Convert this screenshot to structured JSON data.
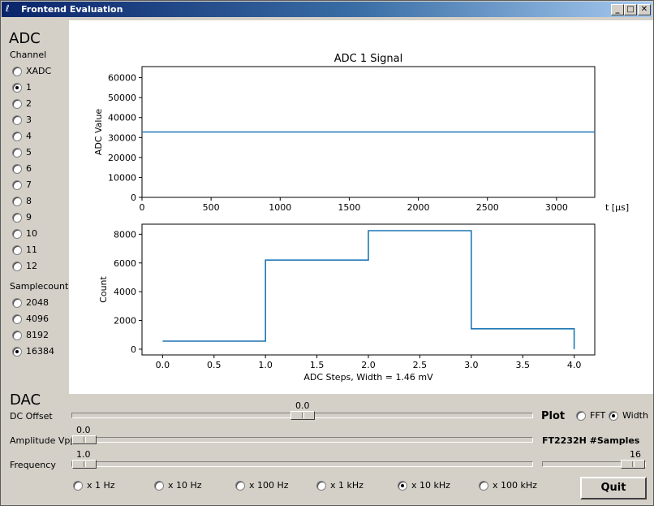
{
  "window": {
    "title": "Frontend Evaluation",
    "minimize": "_",
    "maximize": "□",
    "close": "✕"
  },
  "adc": {
    "heading": "ADC",
    "channel_label": "Channel",
    "channels": [
      "XADC",
      "1",
      "2",
      "3",
      "4",
      "5",
      "6",
      "7",
      "8",
      "9",
      "10",
      "11",
      "12"
    ],
    "channel_selected": "1",
    "samplecount_label": "Samplecount",
    "samplecounts": [
      "2048",
      "4096",
      "8192",
      "16384"
    ],
    "samplecount_selected": "16384"
  },
  "chart_data": [
    {
      "type": "line",
      "title": "ADC 1 Signal",
      "xlabel": "t [μs]",
      "ylabel": "ADC Value",
      "xlim": [
        0,
        3276.8
      ],
      "ylim": [
        0,
        65535
      ],
      "xticks": [
        "0",
        "500",
        "1000",
        "1500",
        "2000",
        "2500",
        "3000"
      ],
      "yticks": [
        "0",
        "10000",
        "20000",
        "30000",
        "40000",
        "50000",
        "60000"
      ],
      "series": [
        {
          "x": [
            0,
            3276.8
          ],
          "y": [
            32768,
            32768
          ]
        }
      ],
      "color": "#1f77b4"
    },
    {
      "type": "line",
      "title": "",
      "xlabel": "ADC Steps, Width = 1.46 mV",
      "ylabel": "Count",
      "xlim": [
        -0.2,
        4.2
      ],
      "ylim": [
        -400,
        8700
      ],
      "xticks": [
        "0.0",
        "0.5",
        "1.0",
        "1.5",
        "2.0",
        "2.5",
        "3.0",
        "3.5",
        "4.0"
      ],
      "yticks": [
        "0",
        "2000",
        "4000",
        "6000",
        "8000"
      ],
      "series": [
        {
          "x": [
            0,
            1,
            1,
            2,
            2,
            3,
            3,
            4,
            4
          ],
          "y": [
            560,
            560,
            6200,
            6200,
            8250,
            8250,
            1420,
            1420,
            0
          ]
        }
      ],
      "color": "#1f77b4"
    }
  ],
  "dac": {
    "heading": "DAC",
    "dc_offset_label": "DC Offset",
    "dc_offset_value": "0.0",
    "amplitude_label": "Amplitude Vpp",
    "amplitude_value": "0.0",
    "frequency_label": "Frequency",
    "frequency_value": "1.0",
    "multipliers": [
      "x 1 Hz",
      "x 10 Hz",
      "x 100 Hz",
      "x 1 kHz",
      "x 10 kHz",
      "x 100 kHz"
    ],
    "multiplier_selected": "x 10 kHz"
  },
  "plot": {
    "label": "Plot",
    "options": [
      "FFT",
      "Width"
    ],
    "selected": "Width",
    "samples_label": "FT2232H #Samples",
    "samples_value": "16",
    "quit": "Quit"
  }
}
